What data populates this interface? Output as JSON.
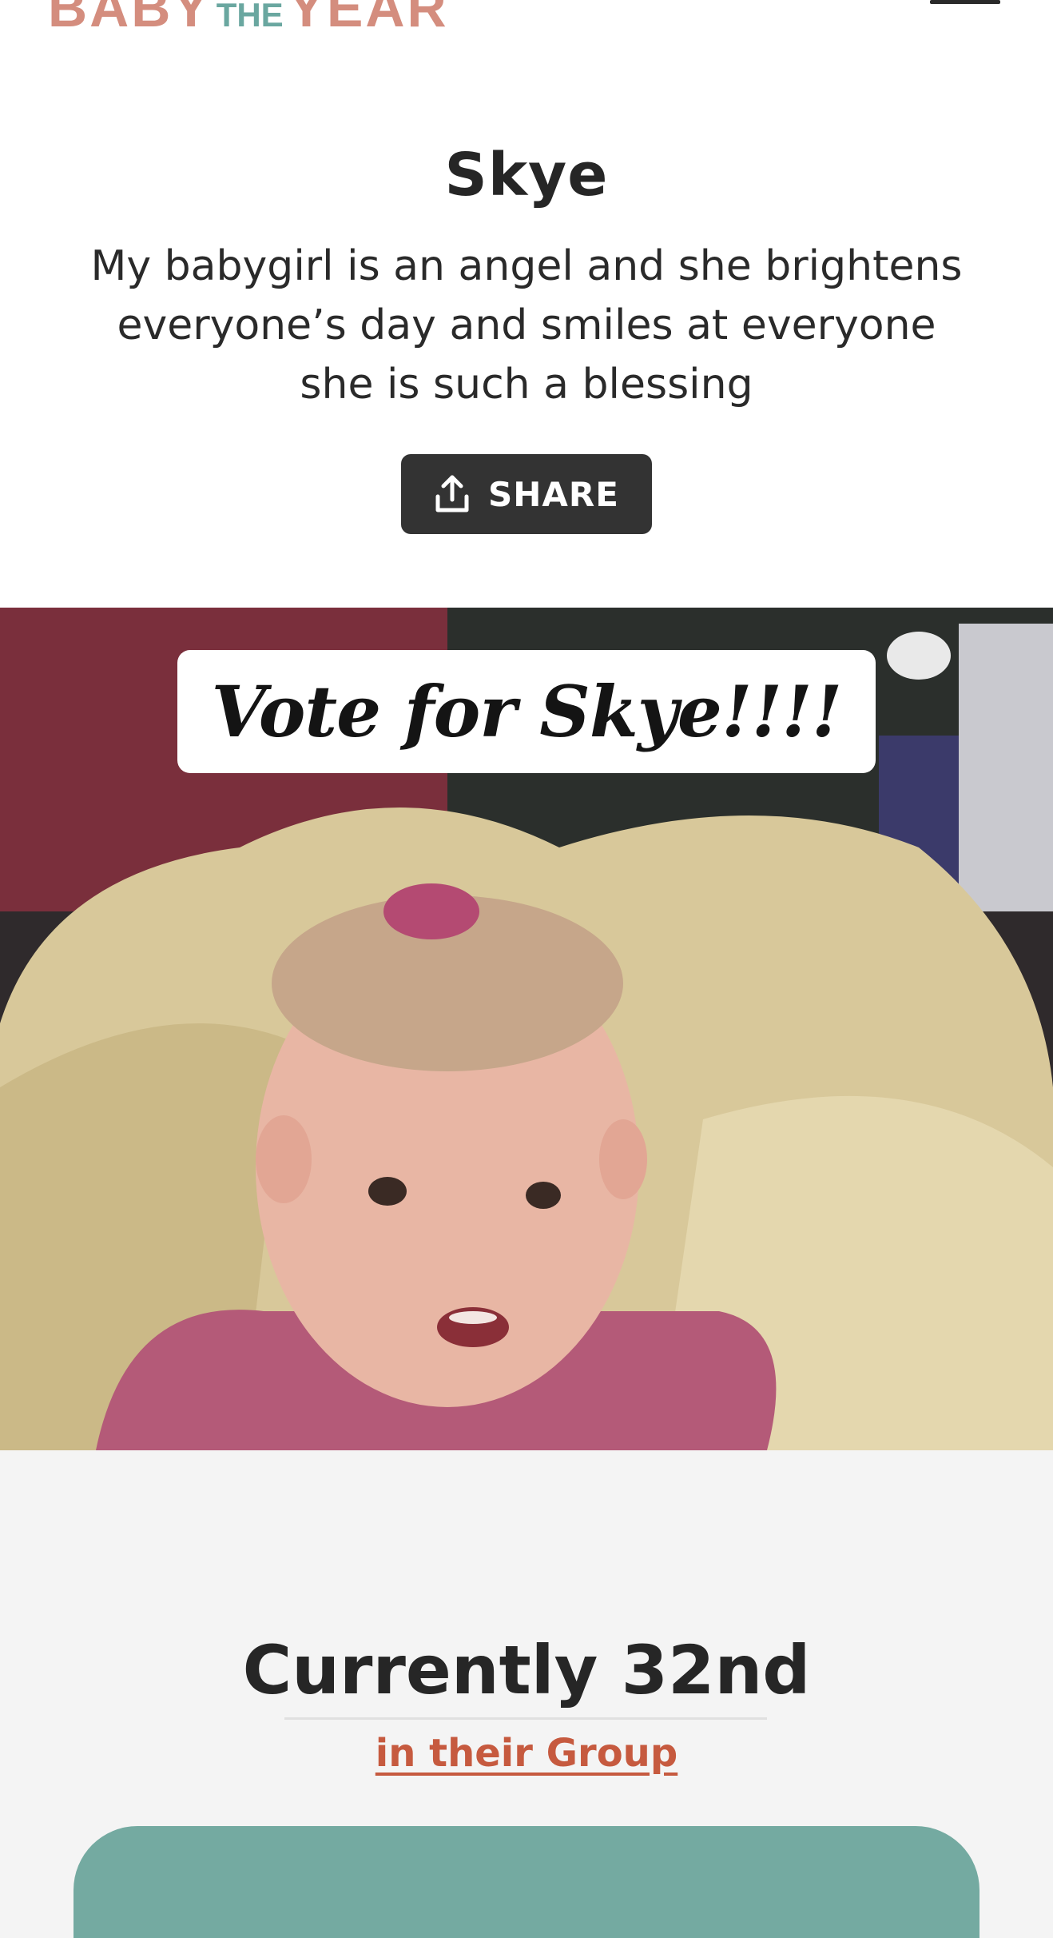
{
  "header": {
    "logo": {
      "word1": "BABY",
      "word2": "THE",
      "word3": "YEAR"
    },
    "menu_icon": "hamburger-menu-icon"
  },
  "profile": {
    "name": "Skye",
    "bio": "My babygirl is an angel and she brightens everyone’s day and smiles at everyone she is such a blessing",
    "share_label": "SHARE",
    "share_icon": "upload-share-icon"
  },
  "photo": {
    "caption": "Vote for Skye!!!!"
  },
  "ranking": {
    "title": "Currently 32nd",
    "group_link": "in their Group"
  },
  "colors": {
    "logo_coral": "#d48d7e",
    "logo_teal": "#6aa7a0",
    "share_button": "#333333",
    "link": "#c65a3f",
    "vote_button": "#74aaa1",
    "page_bg": "#f4f4f4"
  }
}
